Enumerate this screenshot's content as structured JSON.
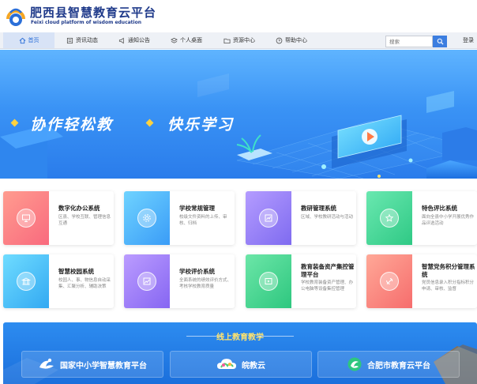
{
  "site": {
    "title": "肥西县智慧教育云平台",
    "subtitle": "Feixi cloud platform of wisdom education"
  },
  "nav": {
    "items": [
      {
        "label": "首页",
        "icon": "home-icon",
        "active": true
      },
      {
        "label": "资讯动态",
        "icon": "news-icon",
        "active": false
      },
      {
        "label": "通知公告",
        "icon": "notice-icon",
        "active": false
      },
      {
        "label": "个人桌面",
        "icon": "layers-icon",
        "active": false
      },
      {
        "label": "资源中心",
        "icon": "folder-icon",
        "active": false
      },
      {
        "label": "帮助中心",
        "icon": "help-icon",
        "active": false
      }
    ],
    "search_placeholder": "搜索",
    "login_label": "登录"
  },
  "banner": {
    "slogan_left": "协作轻松教",
    "slogan_right": "快乐学习"
  },
  "apps": [
    {
      "title": "数字化办公系统",
      "desc": "区县、学校互联、管理信息互通",
      "icon": "monitor-icon",
      "color_from": "#ff8a8a",
      "color_to": "#f96a7e"
    },
    {
      "title": "学校常规管理",
      "desc": "校级文件资料的上传、审核、归档",
      "icon": "gear-icon",
      "color_from": "#5cc8ff",
      "color_to": "#3a9cf7"
    },
    {
      "title": "教研管理系统",
      "desc": "区域、学校教研活动与活动",
      "icon": "chart-icon",
      "color_from": "#a88cff",
      "color_to": "#7f6bf0"
    },
    {
      "title": "特色评比系统",
      "desc": "面向全县中小学开展优秀作品评选活动",
      "icon": "star-icon",
      "color_from": "#5de3a6",
      "color_to": "#2fc985"
    },
    {
      "title": "智慧校园系统",
      "desc": "校园人、事、物信息自动采集、汇聚分析、辅助决策",
      "icon": "building-icon",
      "color_from": "#5cd2ff",
      "color_to": "#33a9f2"
    },
    {
      "title": "学校评价系统",
      "desc": "全面系统的绩效评价方式、考核学校教育质量",
      "icon": "trend-icon",
      "color_from": "#b08cff",
      "color_to": "#8666f2"
    },
    {
      "title": "教育装备资产集控管理平台",
      "desc": "学校教育装备资产管理、办公电脑等设备集控管理",
      "icon": "video-icon",
      "color_from": "#5fe3a0",
      "color_to": "#2ec77f"
    },
    {
      "title": "智慧党务积分管理系统",
      "desc": "党员信息录入积分指标积分申请、审核、监督",
      "icon": "party-icon",
      "color_from": "#ff9b8a",
      "color_to": "#f66d6d"
    }
  ],
  "online": {
    "title": "线上教育教学",
    "platforms": [
      {
        "label": "国家中小学智慧教育平台",
        "icon": "national-edu-logo-icon"
      },
      {
        "label": "皖教云",
        "icon": "cloud-logo-icon"
      },
      {
        "label": "合肥市教育云平台",
        "icon": "hefei-edu-logo-icon"
      }
    ]
  },
  "colors": {
    "brand_blue": "#2b6fd8",
    "banner_blue": "#3a93f5",
    "slogan_diamond": "#ffd23f",
    "online_title": "#ffe36e"
  }
}
